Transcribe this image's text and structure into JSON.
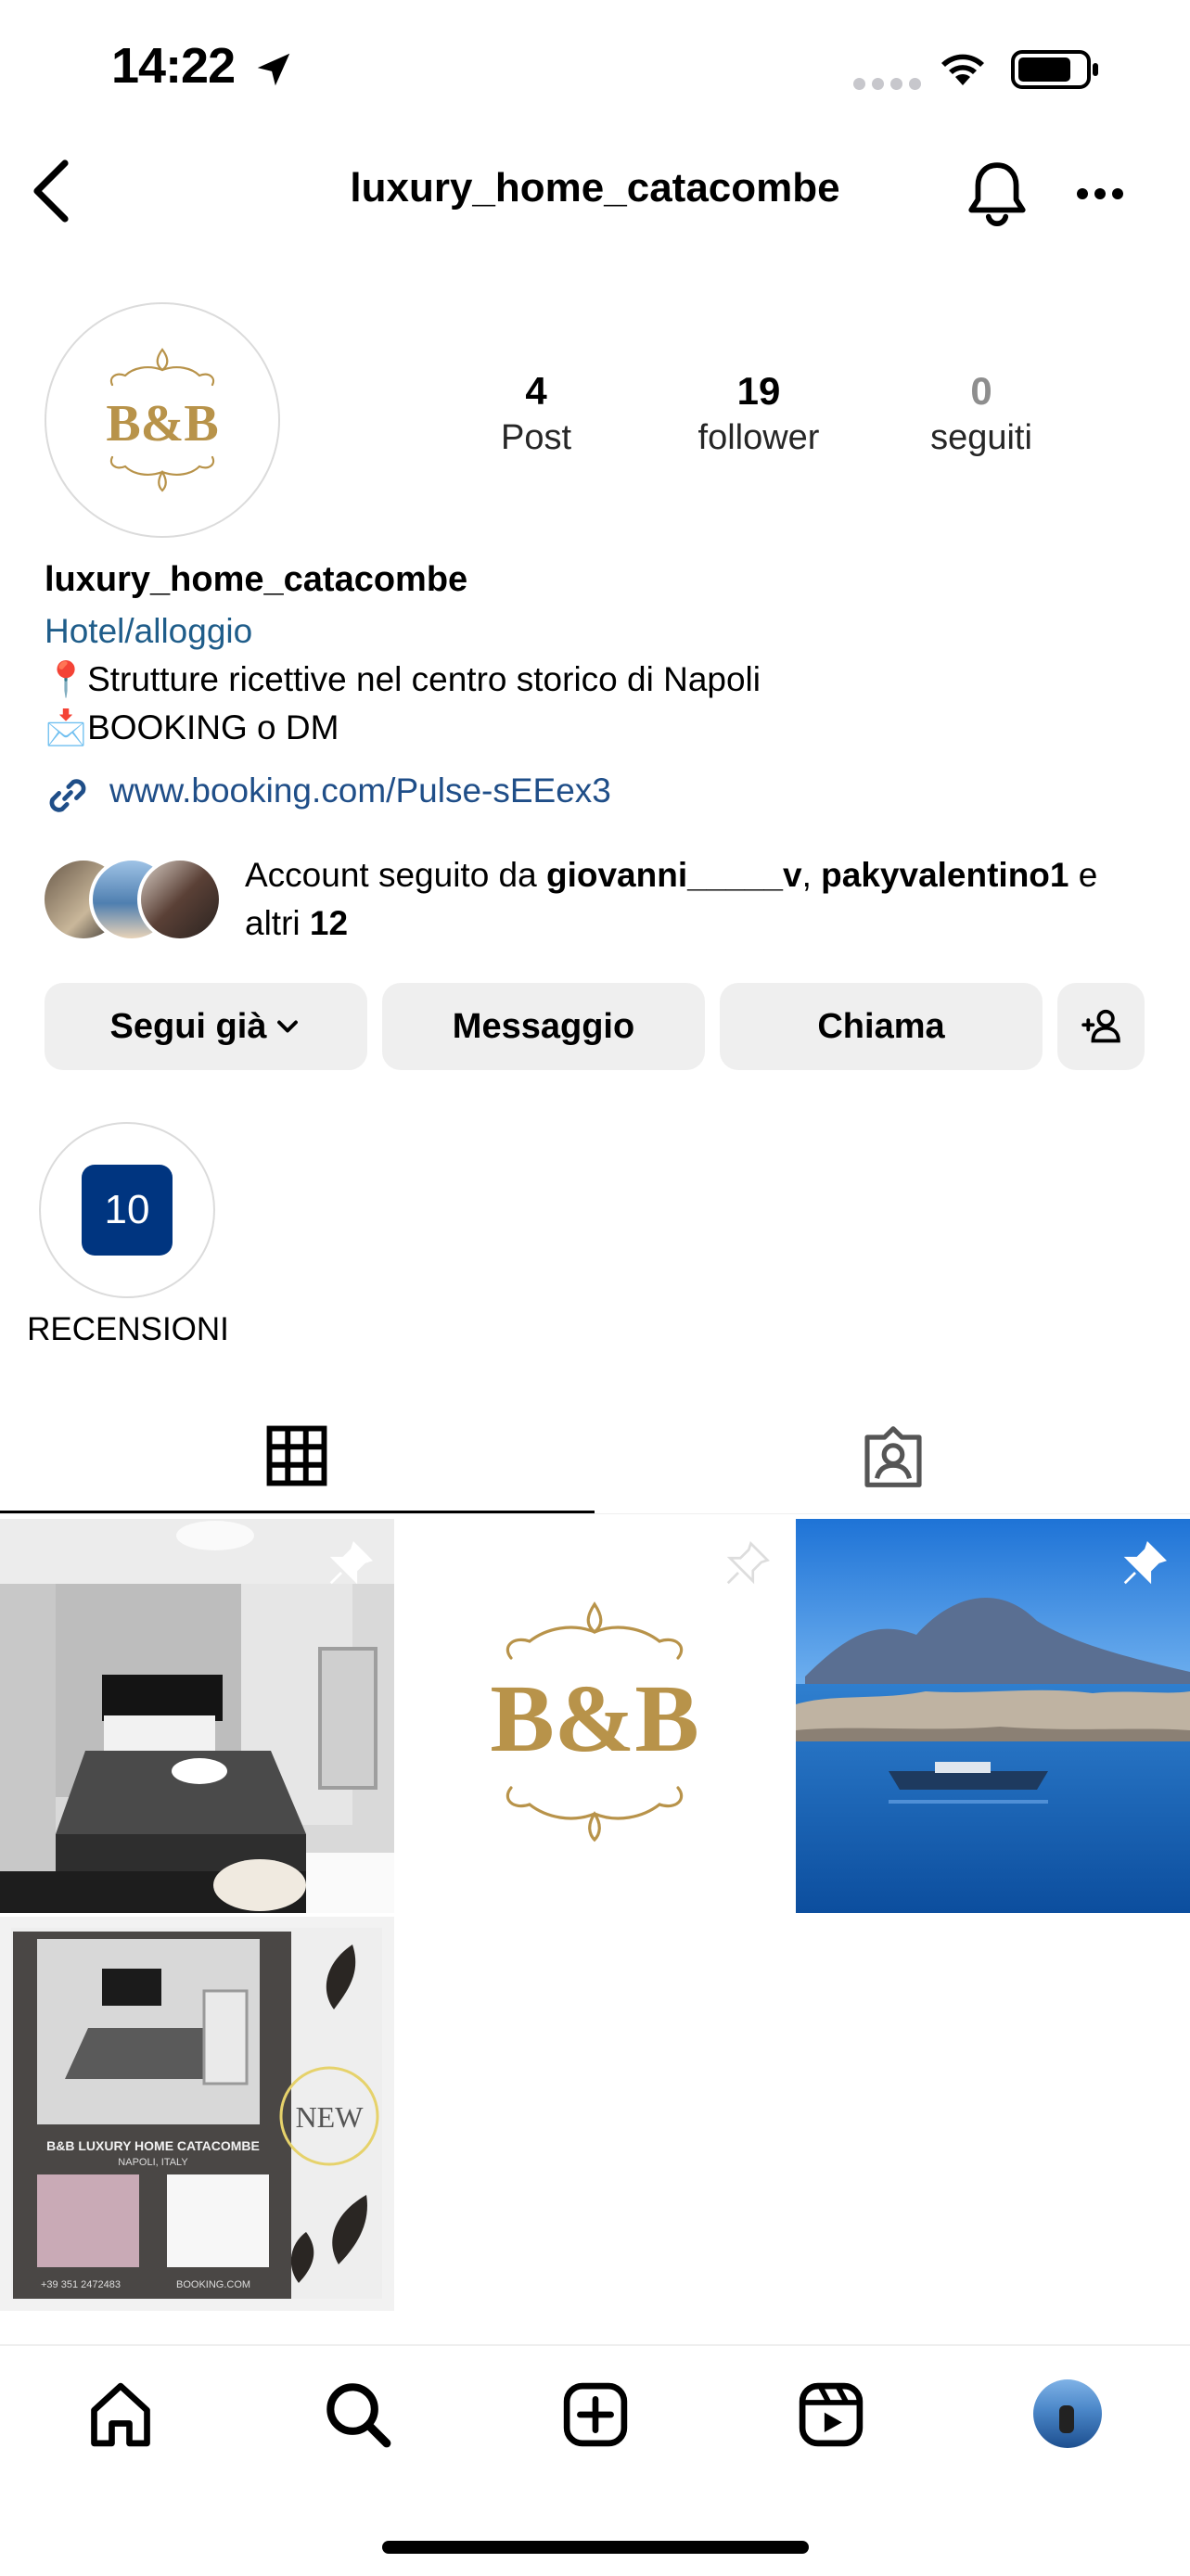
{
  "status_bar": {
    "time": "14:22"
  },
  "header": {
    "title": "luxury_home_catacombe"
  },
  "profile": {
    "avatar_logo": "B&B",
    "stats": [
      {
        "value": "4",
        "label": "Post"
      },
      {
        "value": "19",
        "label": "follower"
      },
      {
        "value": "0",
        "label": "seguiti"
      }
    ],
    "name": "luxury_home_catacombe",
    "category": "Hotel/alloggio",
    "bio_lines": [
      "📍Strutture ricettive nel centro storico di Napoli",
      "📩BOOKING o DM"
    ],
    "link": "www.booking.com/Pulse-sEEex3",
    "followed_by": {
      "prefix": "Account seguito da ",
      "user1": "giovanni_____v",
      "sep": ", ",
      "user2": "pakyvalentino1",
      "mid": " e",
      "others_prefix": "altri ",
      "others_count": "12"
    }
  },
  "buttons": {
    "following": "Segui già",
    "message": "Messaggio",
    "call": "Chiama"
  },
  "highlights": [
    {
      "badge": "10",
      "label": "RECENSIONI"
    }
  ],
  "posts": [
    {
      "type": "bedroom-photo",
      "pinned": true
    },
    {
      "type": "logo",
      "logo": "B&B",
      "pinned": true
    },
    {
      "type": "sea-photo",
      "pinned": true
    },
    {
      "type": "flyer",
      "flyer_title": "B&B LUXURY HOME CATACOMBE",
      "flyer_sub": "NAPOLI, ITALY",
      "flyer_new": "NEW",
      "flyer_phone": "+39 351 2472483",
      "flyer_site": "BOOKING.COM",
      "pinned": false
    }
  ],
  "colors": {
    "booking_blue": "#003580",
    "link_blue": "#1f4e88",
    "button_grey": "#efefef",
    "gold": "#b8934a"
  }
}
